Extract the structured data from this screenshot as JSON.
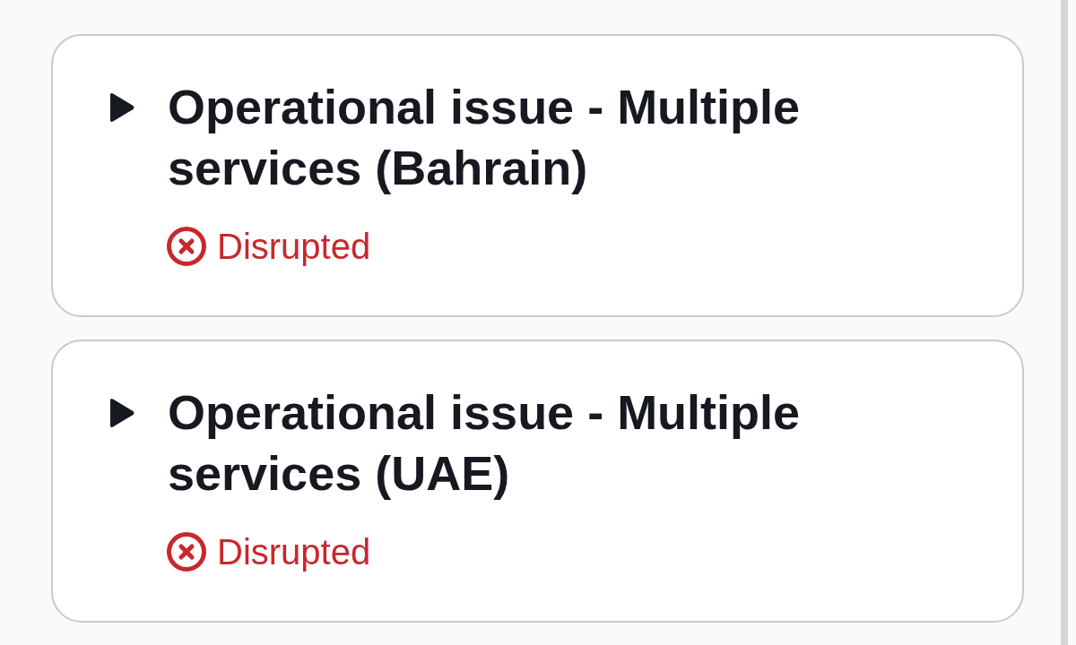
{
  "issues": [
    {
      "title": "Operational issue - Multiple services (Bahrain)",
      "expanded": false,
      "status": {
        "kind": "disrupted",
        "label": "Disrupted"
      }
    },
    {
      "title": "Operational issue - Multiple services (UAE)",
      "expanded": false,
      "status": {
        "kind": "disrupted",
        "label": "Disrupted"
      }
    }
  ]
}
